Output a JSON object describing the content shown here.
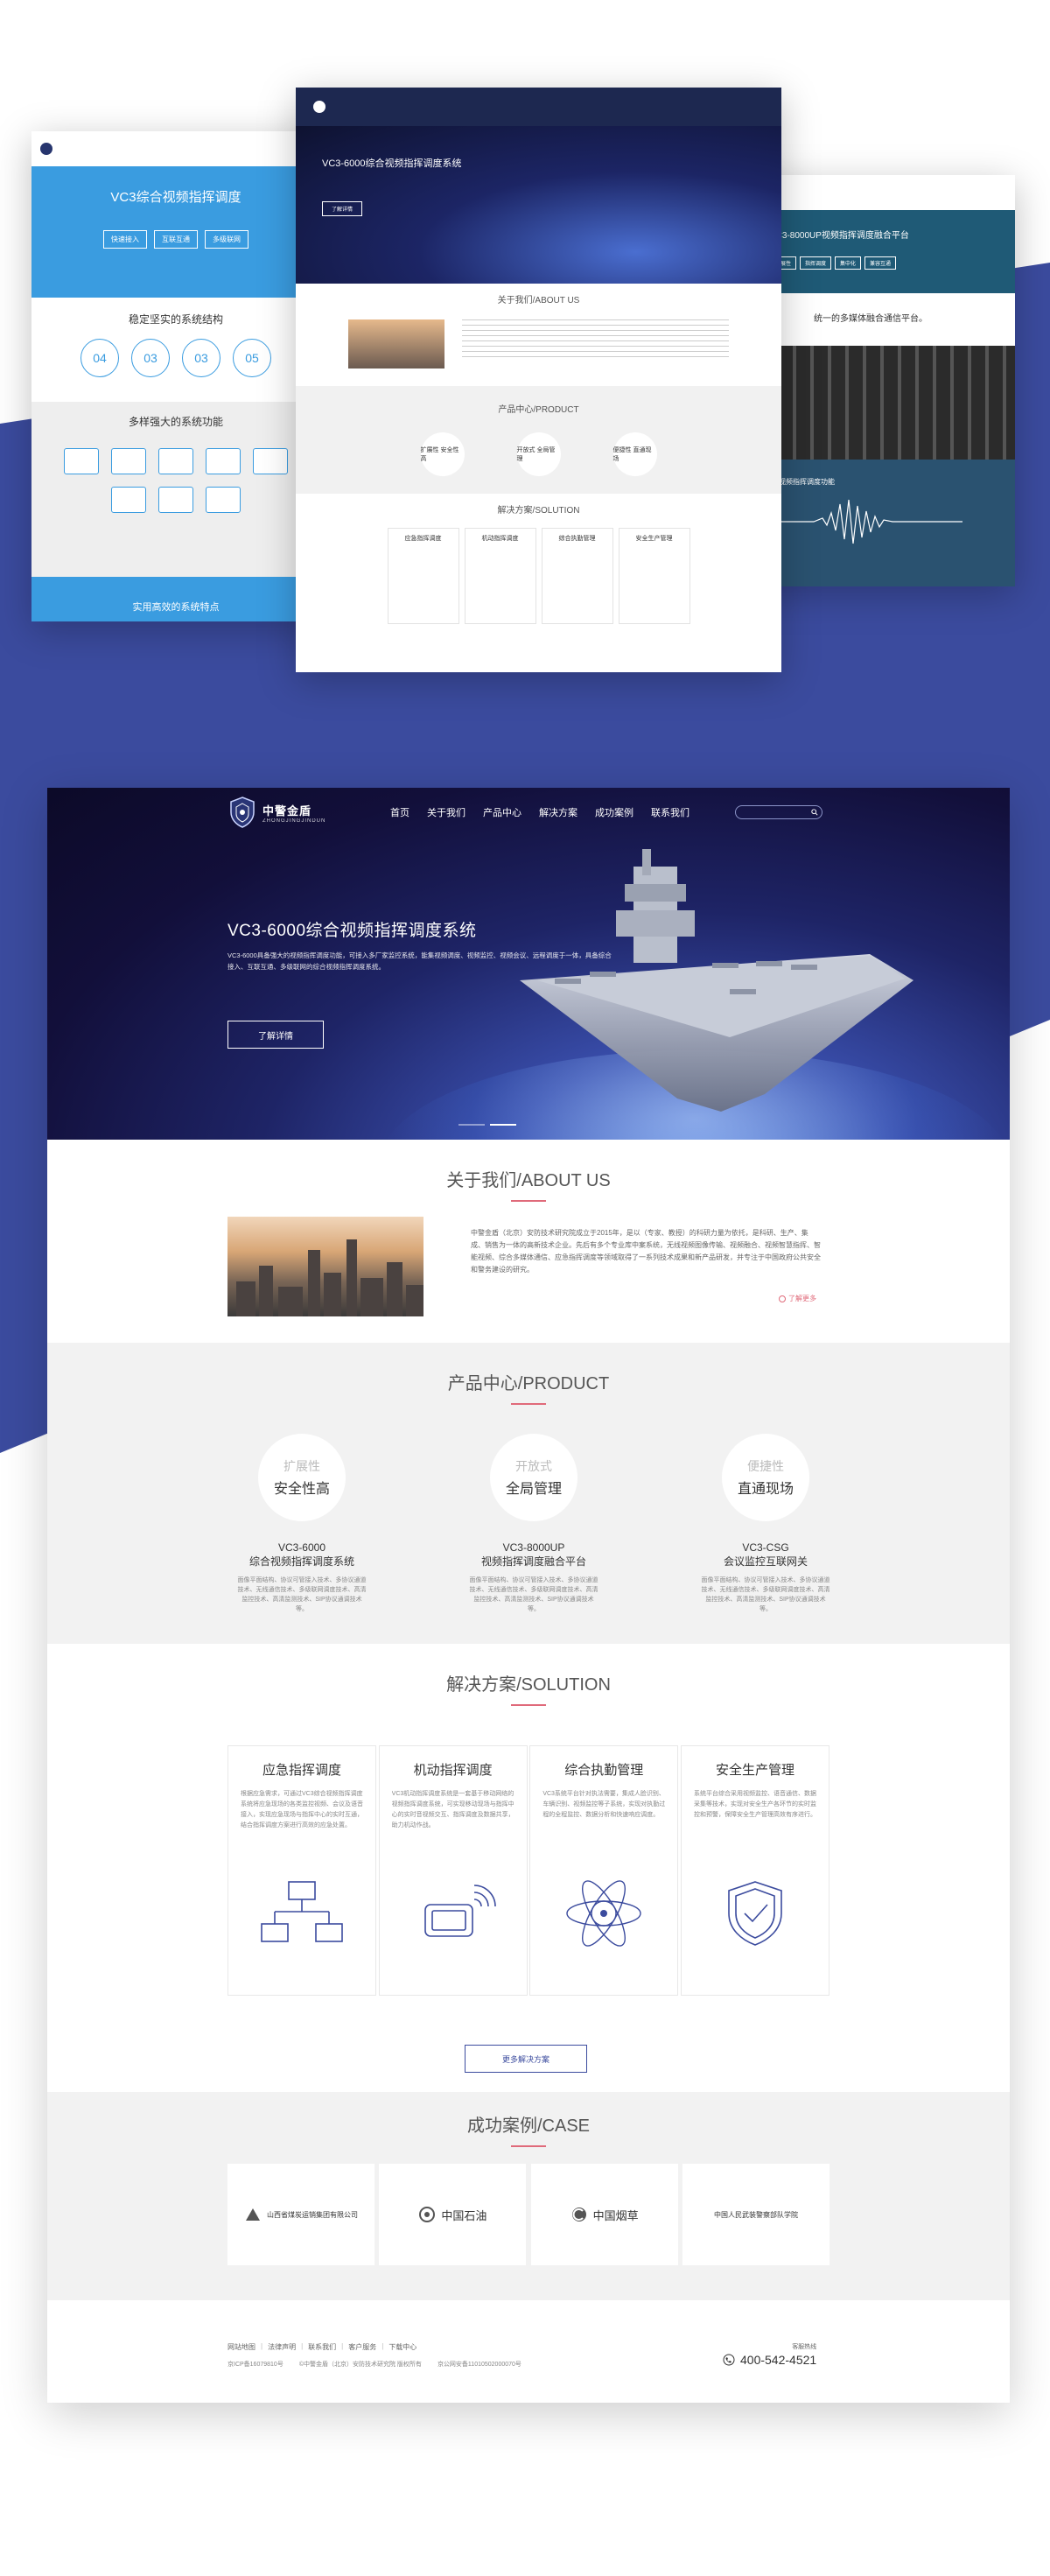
{
  "mockups": {
    "left": {
      "banner_title": "VC3综合视频指挥调度",
      "buttons": [
        "快速接入",
        "互联互通",
        "多级联网"
      ],
      "section1": "稳定坚实的系统结构",
      "circles": [
        "04",
        "03",
        "03",
        "05"
      ],
      "section2": "多样强大的系统功能",
      "footer_text": "实用高效的系统特点"
    },
    "center": {
      "hero_title": "VC3-6000综合视频指挥调度系统",
      "hero_btn": "了解详情",
      "about": "关于我们/ABOUT US",
      "product": "产品中心/PRODUCT",
      "products": [
        "扩展性 安全性高",
        "开放式 全局管理",
        "便捷性 直通现场"
      ],
      "solution": "解决方案/SOLUTION",
      "solutions": [
        "应急指挥调度",
        "机动指挥调度",
        "综合执勤管理",
        "安全生产管理"
      ]
    },
    "right": {
      "banner_title": "VC3-8000UP视频指挥调度融合平台",
      "tags": [
        "扩展性",
        "指挥调度",
        "集中化",
        "兼容互通"
      ],
      "mid_text": "统一的多媒体融合通信平台。",
      "wave_title": "视频指挥调度功能"
    }
  },
  "brand": {
    "name_cn": "中警金盾",
    "name_en": "ZHONGJINGJINDUN"
  },
  "nav": {
    "items": [
      "首页",
      "关于我们",
      "产品中心",
      "解决方案",
      "成功案例",
      "联系我们"
    ],
    "search_placeholder": ""
  },
  "hero": {
    "title": "VC3-6000综合视频指挥调度系统",
    "desc": "VC3-6000具备强大的视频指挥调度功能，可接入多厂家监控系统，能集视频调度、视频监控、视频会议、远程调度于一体，具备综合接入、互联互通、多级联网的综合视频指挥调度系统。",
    "button": "了解详情"
  },
  "about": {
    "title": "关于我们/ABOUT US",
    "text": "中警金盾（北京）安防技术研究院成立于2015年，是以（专家、教授）的科研力量为依托，是科研、生产、集成、销售为一体的高新技术企业。先后有多个专业库中案系统，无线视频图像传输、视频融合、视频智慧指挥、智能视频、综合多媒体通信、应急指挥调度等领域取得了一系列技术成果和新产品研发，并专注于中国政府公共安全和警务建设的研究。",
    "more": "了解更多"
  },
  "product": {
    "title": "产品中心/PRODUCT",
    "items": [
      {
        "gray": "扩展性",
        "bold": "安全性高",
        "name1": "VC3-6000",
        "name2": "综合视频指挥调度系统",
        "desc": "面像平面结构、协议可管接入技术、多协议通道技术、无线通信技术、多级联网调度技术、高清监控技术、高清监测技术、SIP协议通调技术等。"
      },
      {
        "gray": "开放式",
        "bold": "全局管理",
        "name1": "VC3-8000UP",
        "name2": "视频指挥调度融合平台",
        "desc": "面像平面结构、协议可管接入技术、多协议通道技术、无线通信技术、多级联网调度技术、高清监控技术、高清监测技术、SIP协议通调技术等。"
      },
      {
        "gray": "便捷性",
        "bold": "直通现场",
        "name1": "VC3-CSG",
        "name2": "会议监控互联网关",
        "desc": "面像平面结构、协议可管接入技术、多协议通道技术、无线通信技术、多级联网调度技术、高清监控技术、高清监测技术、SIP协议通调技术等。"
      }
    ]
  },
  "solution": {
    "title": "解决方案/SOLUTION",
    "items": [
      {
        "title": "应急指挥调度",
        "desc": "根据应急需求，可通过VC3综合视频指挥调度系统将应急现场的各类监控视频、会议及语音接入，实现应急现场与指挥中心的实时互通，结合指挥调度方案进行高效的应急处置。",
        "icon": "network-icon"
      },
      {
        "title": "机动指挥调度",
        "desc": "VC3机动指挥调度系统是一套基于移动网络的视频指挥调度系统，可实现移动现场与指挥中心的实时音视频交互、指挥调度及数据共享，助力机动作战。",
        "icon": "mobile-signal-icon"
      },
      {
        "title": "综合执勤管理",
        "desc": "VC3系统平台针对执法需要，集成人脸识别、车辆识别、视频监控等子系统，实现对执勤过程的全程监控、数据分析和快速响应调度。",
        "icon": "atom-icon"
      },
      {
        "title": "安全生产管理",
        "desc": "系统平台综合采用视频监控、语音通信、数据采集等技术，实现对安全生产各环节的实时监控和预警，保障安全生产管理高效有序进行。",
        "icon": "shield-icon"
      }
    ],
    "more": "更多解决方案"
  },
  "cases": {
    "title": "成功案例/CASE",
    "items": [
      {
        "name": "山西省煤炭运销集团有限公司",
        "icon": "coal-logo-icon"
      },
      {
        "name": "中国石油",
        "icon": "petrochina-logo-icon"
      },
      {
        "name": "中国烟草",
        "icon": "tobacco-logo-icon"
      },
      {
        "name": "中国人民武装警察部队学院",
        "icon": "police-academy-logo-icon"
      }
    ]
  },
  "footer": {
    "links": [
      "网站地图",
      "法律声明",
      "联系我们",
      "客户服务",
      "下载中心"
    ],
    "copy": [
      "京ICP备16079810号",
      "©中警金盾（北京）安防技术研究院 版权所有",
      "京公网安备11010502000070号"
    ],
    "hot_label": "客服热线",
    "phone": "400-542-4521"
  },
  "colors": {
    "accent": "#3b4b9e",
    "pink": "#e06a7a",
    "hero_dark": "#120f3a"
  }
}
